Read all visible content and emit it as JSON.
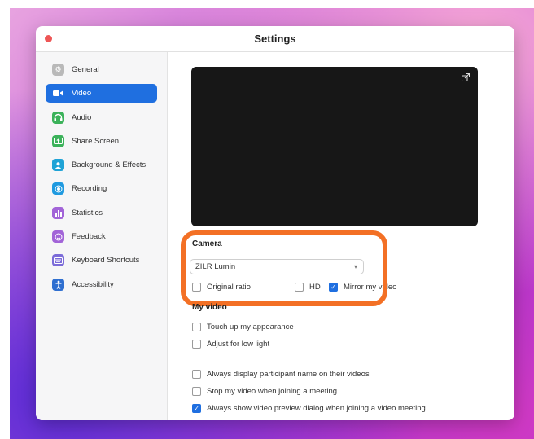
{
  "window": {
    "title": "Settings"
  },
  "sidebar": {
    "items": [
      {
        "label": "General",
        "icon": "gear-icon",
        "color": "#b9b9b9",
        "active": false
      },
      {
        "label": "Video",
        "icon": "video-camera-icon",
        "color": "#1f6fe0",
        "active": true
      },
      {
        "label": "Audio",
        "icon": "headphones-icon",
        "color": "#3bb25a",
        "active": false
      },
      {
        "label": "Share Screen",
        "icon": "share-screen-icon",
        "color": "#3bb25a",
        "active": false
      },
      {
        "label": "Background & Effects",
        "icon": "background-icon",
        "color": "#1fa3d6",
        "active": false
      },
      {
        "label": "Recording",
        "icon": "record-icon",
        "color": "#1f9ae0",
        "active": false
      },
      {
        "label": "Statistics",
        "icon": "bar-chart-icon",
        "color": "#a264d8",
        "active": false
      },
      {
        "label": "Feedback",
        "icon": "feedback-icon",
        "color": "#a264d8",
        "active": false
      },
      {
        "label": "Keyboard Shortcuts",
        "icon": "keyboard-icon",
        "color": "#7b6bd8",
        "active": false
      },
      {
        "label": "Accessibility",
        "icon": "accessibility-icon",
        "color": "#2f6fd0",
        "active": false
      }
    ]
  },
  "camera": {
    "heading": "Camera",
    "selected": "ZILR Lumin",
    "options": [
      {
        "label": "Original ratio",
        "checked": false
      },
      {
        "label": "HD",
        "checked": false
      },
      {
        "label": "Mirror my video",
        "checked": true
      }
    ]
  },
  "my_video": {
    "heading": "My video",
    "options": [
      {
        "label": "Touch up my appearance",
        "checked": false
      },
      {
        "label": "Adjust for low light",
        "checked": false
      }
    ]
  },
  "general_video": {
    "options": [
      {
        "label": "Always display participant name on their videos",
        "checked": false
      },
      {
        "label": "Stop my video when joining a meeting",
        "checked": false
      },
      {
        "label": "Always show video preview dialog when joining a video meeting",
        "checked": true
      }
    ]
  },
  "colors": {
    "accent": "#1f6fe0",
    "highlight": "#f37025"
  }
}
